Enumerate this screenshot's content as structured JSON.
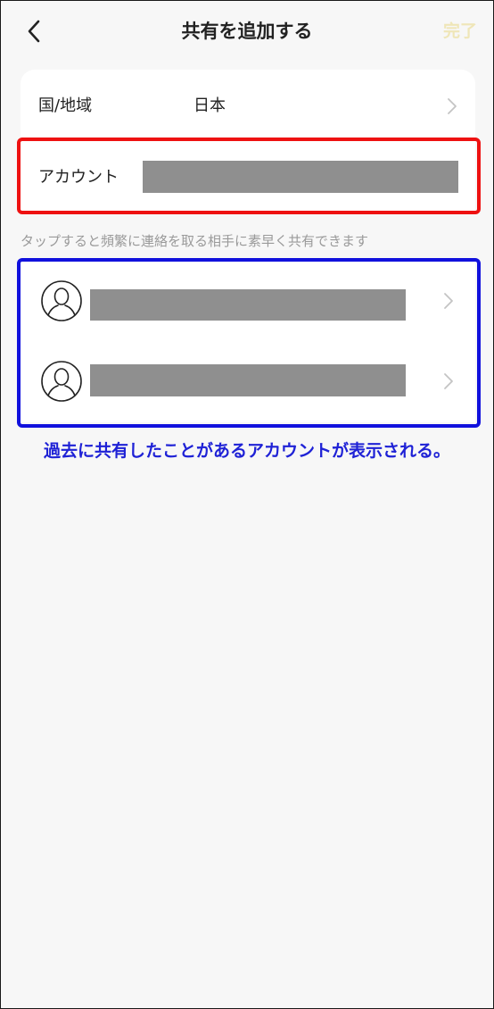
{
  "header": {
    "back_icon": "chevron-left-icon",
    "title": "共有を追加する",
    "done_label": "完了",
    "done_color": "#efe6b8"
  },
  "form": {
    "region_label": "国/地域",
    "region_value": "日本",
    "account_label": "アカウント"
  },
  "hint": "タップすると頻繁に連絡を取る相手に素早く共有できます",
  "recent_contacts": [
    {
      "avatar_icon": "user-avatar-icon"
    },
    {
      "avatar_icon": "user-avatar-icon"
    }
  ],
  "annotation": "過去に共有したことがあるアカウントが表示される。",
  "colors": {
    "red_highlight": "#ee1111",
    "blue_highlight": "#1111dd",
    "annotation_text": "#1f22d6",
    "redaction": "#8f8f8f"
  }
}
